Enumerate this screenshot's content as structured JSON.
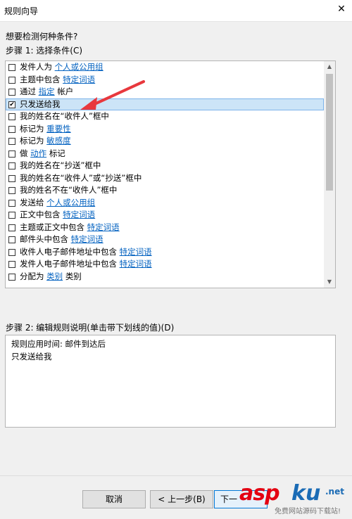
{
  "window": {
    "title": "规则向导",
    "close_glyph": "✕"
  },
  "question": "想要检测何种条件?",
  "step1_label": "步骤 1: 选择条件(C)",
  "conditions": [
    {
      "text": "发件人为",
      "link": "个人或公用组",
      "suffix": "",
      "checked": false
    },
    {
      "text": "主题中包含",
      "link": "特定词语",
      "suffix": "",
      "checked": false
    },
    {
      "text": "通过",
      "link": "指定",
      "suffix": "帐户",
      "checked": false
    },
    {
      "text": "只发送给我",
      "link": "",
      "suffix": "",
      "checked": true
    },
    {
      "text": "我的姓名在“收件人”框中",
      "link": "",
      "suffix": "",
      "checked": false
    },
    {
      "text": "标记为",
      "link": "重要性",
      "suffix": "",
      "checked": false
    },
    {
      "text": "标记为",
      "link": "敏感度",
      "suffix": "",
      "checked": false
    },
    {
      "text": "做",
      "link": "动作",
      "suffix": "标记",
      "checked": false
    },
    {
      "text": "我的姓名在“抄送”框中",
      "link": "",
      "suffix": "",
      "checked": false
    },
    {
      "text": "我的姓名在“收件人”或“抄送”框中",
      "link": "",
      "suffix": "",
      "checked": false
    },
    {
      "text": "我的姓名不在“收件人”框中",
      "link": "",
      "suffix": "",
      "checked": false
    },
    {
      "text": "发送给",
      "link": "个人或公用组",
      "suffix": "",
      "checked": false
    },
    {
      "text": "正文中包含",
      "link": "特定词语",
      "suffix": "",
      "checked": false
    },
    {
      "text": "主题或正文中包含",
      "link": "特定词语",
      "suffix": "",
      "checked": false
    },
    {
      "text": "邮件头中包含",
      "link": "特定词语",
      "suffix": "",
      "checked": false
    },
    {
      "text": "收件人电子邮件地址中包含",
      "link": "特定词语",
      "suffix": "",
      "checked": false
    },
    {
      "text": "发件人电子邮件地址中包含",
      "link": "特定词语",
      "suffix": "",
      "checked": false
    },
    {
      "text": "分配为",
      "link": "类别",
      "suffix": "类别",
      "checked": false
    }
  ],
  "selected_index": 3,
  "step2_label": "步骤 2: 编辑规则说明(单击带下划线的值)(D)",
  "description": [
    "规则应用时间: 邮件到达后",
    "只发送给我"
  ],
  "buttons": {
    "cancel": "取消",
    "back": "< 上一步(B)",
    "next": "下一"
  },
  "watermark": {
    "brand_red": "asp",
    "brand_blue": "ku",
    "tld": ".net",
    "tagline": "免费网站源码下载站!"
  },
  "colors": {
    "link": "#0563c1",
    "selection": "#cce4f7",
    "annotation_arrow": "#e8383d",
    "watermark_red": "#e40012",
    "watermark_blue": "#1a6bb5"
  },
  "scrollbar": {
    "up_glyph": "▲",
    "down_glyph": "▼"
  }
}
